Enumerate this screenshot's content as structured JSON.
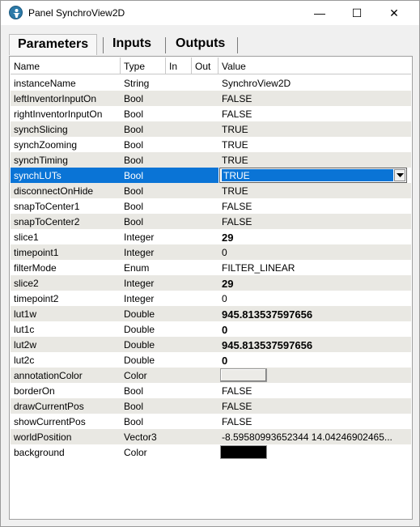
{
  "window": {
    "title": "Panel SynchroView2D",
    "minimize_glyph": "—",
    "maximize_glyph": "☐",
    "close_glyph": "✕"
  },
  "tabs": [
    {
      "label": "Parameters",
      "active": true
    },
    {
      "label": "Inputs",
      "active": false
    },
    {
      "label": "Outputs",
      "active": false
    }
  ],
  "columns": {
    "name": "Name",
    "type": "Type",
    "in": "In",
    "out": "Out",
    "value": "Value"
  },
  "rows": [
    {
      "name": "instanceName",
      "type": "String",
      "value": "SynchroView2D"
    },
    {
      "name": "leftInventorInputOn",
      "type": "Bool",
      "value": "FALSE"
    },
    {
      "name": "rightInventorInputOn",
      "type": "Bool",
      "value": "FALSE"
    },
    {
      "name": "synchSlicing",
      "type": "Bool",
      "value": "TRUE"
    },
    {
      "name": "synchZooming",
      "type": "Bool",
      "value": "TRUE"
    },
    {
      "name": "synchTiming",
      "type": "Bool",
      "value": "TRUE"
    },
    {
      "name": "synchLUTs",
      "type": "Bool",
      "value": "TRUE"
    },
    {
      "name": "disconnectOnHide",
      "type": "Bool",
      "value": "TRUE"
    },
    {
      "name": "snapToCenter1",
      "type": "Bool",
      "value": "FALSE"
    },
    {
      "name": "snapToCenter2",
      "type": "Bool",
      "value": "FALSE"
    },
    {
      "name": "slice1",
      "type": "Integer",
      "value": "29"
    },
    {
      "name": "timepoint1",
      "type": "Integer",
      "value": "0"
    },
    {
      "name": "filterMode",
      "type": "Enum",
      "value": "FILTER_LINEAR"
    },
    {
      "name": "slice2",
      "type": "Integer",
      "value": "29"
    },
    {
      "name": "timepoint2",
      "type": "Integer",
      "value": "0"
    },
    {
      "name": "lut1w",
      "type": "Double",
      "value": "945.813537597656"
    },
    {
      "name": "lut1c",
      "type": "Double",
      "value": "0"
    },
    {
      "name": "lut2w",
      "type": "Double",
      "value": "945.813537597656"
    },
    {
      "name": "lut2c",
      "type": "Double",
      "value": "0"
    },
    {
      "name": "annotationColor",
      "type": "Color",
      "value": ""
    },
    {
      "name": "borderOn",
      "type": "Bool",
      "value": "FALSE"
    },
    {
      "name": "drawCurrentPos",
      "type": "Bool",
      "value": "FALSE"
    },
    {
      "name": "showCurrentPos",
      "type": "Bool",
      "value": "FALSE"
    },
    {
      "name": "worldPosition",
      "type": "Vector3",
      "value": "-8.59580993652344 14.04246902465..."
    },
    {
      "name": "background",
      "type": "Color",
      "value": ""
    }
  ],
  "styles": {
    "selected_row": 6,
    "bold_rows": [
      10,
      13,
      15,
      16,
      17,
      18
    ],
    "swatch_rows": {
      "19": "#ecebe7",
      "24": "#000000"
    },
    "selection_color": "#0a74d6"
  }
}
